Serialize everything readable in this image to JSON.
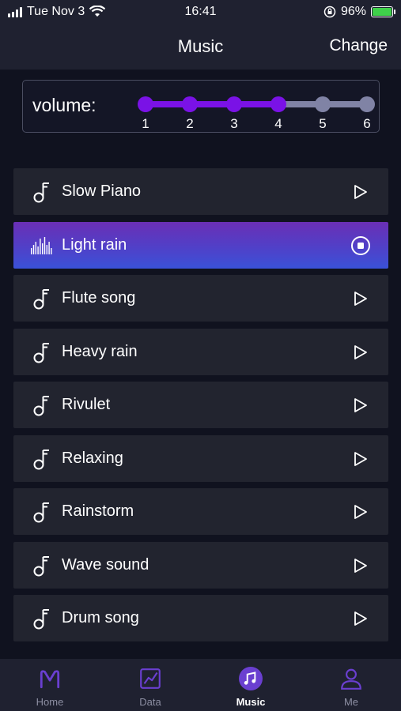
{
  "status_bar": {
    "date": "Tue Nov 3",
    "time": "16:41",
    "battery": "96%"
  },
  "header": {
    "title": "Music",
    "action": "Change"
  },
  "volume": {
    "label": "volume:",
    "levels": [
      "1",
      "2",
      "3",
      "4",
      "5",
      "6"
    ],
    "current_level": 4,
    "active_color": "#7a12e6",
    "inactive_color": "#8083a5"
  },
  "songs": [
    {
      "label": "Slow Piano",
      "state": "play"
    },
    {
      "label": "Light rain",
      "state": "playing"
    },
    {
      "label": "Flute song",
      "state": "play"
    },
    {
      "label": "Heavy rain",
      "state": "play"
    },
    {
      "label": "Rivulet",
      "state": "play"
    },
    {
      "label": "Relaxing",
      "state": "play"
    },
    {
      "label": "Rainstorm",
      "state": "play"
    },
    {
      "label": "Wave sound",
      "state": "play"
    },
    {
      "label": "Drum song",
      "state": "play"
    }
  ],
  "tabs": [
    {
      "label": "Home",
      "icon": "home-logo-icon"
    },
    {
      "label": "Data",
      "icon": "chart-icon"
    },
    {
      "label": "Music",
      "icon": "music-note-icon",
      "active": true
    },
    {
      "label": "Me",
      "icon": "person-icon"
    }
  ],
  "colors": {
    "accent": "#7a12e6",
    "background": "#10121f",
    "row": "#22242f"
  }
}
